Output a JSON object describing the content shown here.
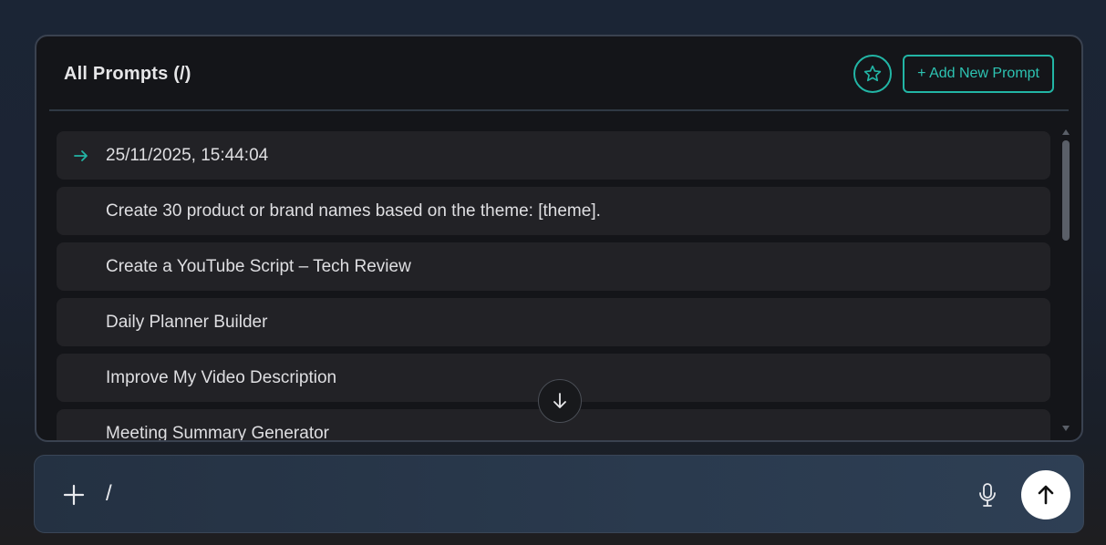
{
  "panel": {
    "title": "All Prompts (/)",
    "add_button_label": "+ Add New Prompt",
    "star_icon": "star-icon"
  },
  "prompts": [
    {
      "label": "25/11/2025, 15:44:04",
      "active": true
    },
    {
      "label": "Create 30 product or brand names based on the theme: [theme]."
    },
    {
      "label": "Create a YouTube Script – Tech Review"
    },
    {
      "label": "Daily Planner Builder"
    },
    {
      "label": "Improve My Video Description"
    },
    {
      "label": "Meeting Summary Generator"
    }
  ],
  "input": {
    "value": "/"
  },
  "colors": {
    "accent": "#22b5a5",
    "panel_bg": "#141519",
    "item_bg": "#222226",
    "send_bg": "#ffffff"
  }
}
